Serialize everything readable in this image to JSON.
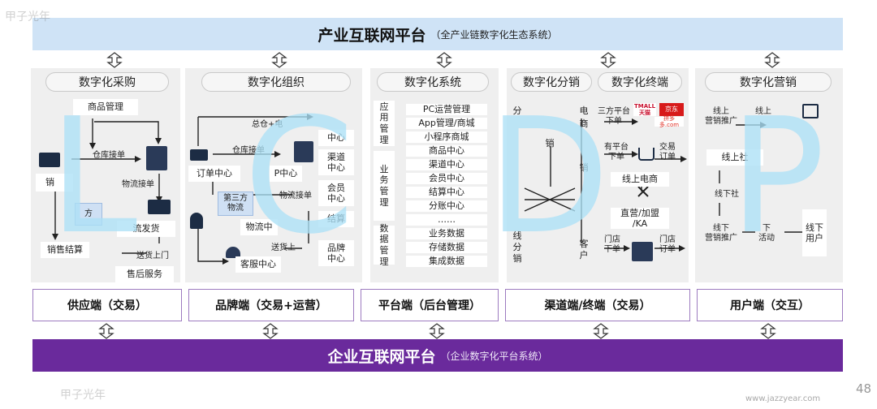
{
  "top": {
    "title": "产业互联网平台",
    "subtitle": "（全产业链数字化生态系统）"
  },
  "bottom": {
    "title": "企业互联网平台",
    "subtitle": "（企业数字化平台系统）"
  },
  "columns": {
    "c1": {
      "header": "数字化采购"
    },
    "c2": {
      "header": "数字化组织"
    },
    "c3": {
      "header": "数字化系统"
    },
    "c4": {
      "header_left": "数字化分销",
      "header_right": "数字化终端"
    },
    "c5": {
      "header": "数字化营销"
    }
  },
  "endpoints": [
    "供应端（交易）",
    "品牌端（交易+运营）",
    "平台端（后台管理）",
    "渠道端/终端（交易）",
    "用户端（交互）"
  ],
  "c1": {
    "product_mgmt": "商品管理",
    "warehouse_order": "仓库接单",
    "sales_order": "销",
    "logistics_order": "物流接单",
    "ship": "流发货",
    "light_box": "方",
    "sales_settle": "销售结算",
    "deliver": "送货上门",
    "after_sales": "售后服务"
  },
  "c2": {
    "hq_label": "总仓+电",
    "warehouse_order": "仓库接单",
    "order_center": "订单中心",
    "p_center": "P中心",
    "third_party": "第三方\n物流",
    "logistics_order": "物流接单",
    "logistics_center": "物流中",
    "deliver": "送货上",
    "cs_center": "客服中心",
    "right_1": "中心",
    "right_2": "渠道\n中心",
    "right_3": "会员\n中心",
    "right_4": "结算",
    "right_5": "品牌\n中心"
  },
  "c3": {
    "group_app": "应用管理",
    "group_biz": "业务管理",
    "group_data": "数据管理",
    "items": [
      "PC运营管理",
      "App管理/商城",
      "小程序商城",
      "商品中心",
      "渠道中心",
      "会员中心",
      "结算中心",
      "分账中心",
      "……",
      "业务数据",
      "存储数据",
      "集成数据"
    ]
  },
  "c4": {
    "fen": "分",
    "xiao": "销",
    "dian": "电",
    "shang": "商",
    "xiao_right": "销",
    "ke": "客",
    "hu": "户",
    "xian": "线",
    "fen2": "分",
    "xiao2": "销",
    "third_party_order": "三方平台\n下单",
    "own_order": "有平台\n下单",
    "trade_order": "交易\n订单",
    "online_ecom": "线上电商",
    "direct_franchise": "直营/加盟\n/KA",
    "store_order": "门店\n下单",
    "store_order2": "门店\n订单",
    "logo_tmall": "TMALL",
    "logo_tmall_sub": "天猫",
    "logo_jd": "京东",
    "logo_pdd": "拼多多.com"
  },
  "c5": {
    "online_promo": "线上\n营销推广",
    "online_top": "线上",
    "online_social": "线上社",
    "offline_social": "线下社",
    "offline_promo": "线下\n营销推广",
    "offline_event": "下\n活动",
    "offline_user": "线下\n用户"
  },
  "watermark": "LCDP",
  "brand_watermark": "甲子光年",
  "footer_url": "www.jazzyear.com",
  "page_number": "48"
}
